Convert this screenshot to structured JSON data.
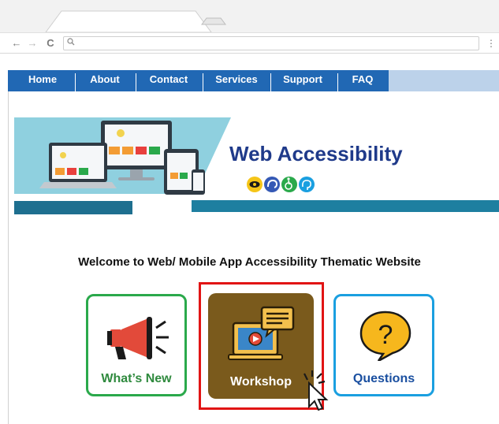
{
  "browser": {
    "back_glyph": "←",
    "forward_glyph": "→",
    "reload_glyph": "C",
    "search_glyph": "🔍",
    "menu_glyph": "⋮"
  },
  "nav": {
    "items": [
      "Home",
      "About",
      "Contact",
      "Services",
      "Support",
      "FAQ"
    ],
    "bg_color": "#2168b4",
    "trail_color": "#bcd2ea"
  },
  "banner": {
    "title": "Web Accessibility",
    "title_color": "#1f3a8a",
    "accent_color": "#7ec8d8",
    "bar_color": "#1e7fa0",
    "icons": [
      "eye-icon",
      "hearing-icon",
      "wheelchair-icon",
      "cognitive-icon"
    ]
  },
  "welcome": {
    "text": "Welcome to Web/ Mobile App Accessibility Thematic Website"
  },
  "cards": {
    "whats_new": {
      "label": "What’s New",
      "color": "#2aa94b"
    },
    "workshop": {
      "label": "Workshop",
      "color": "#7a5a1c"
    },
    "questions": {
      "label": "Questions",
      "color": "#1a9fe0"
    }
  }
}
